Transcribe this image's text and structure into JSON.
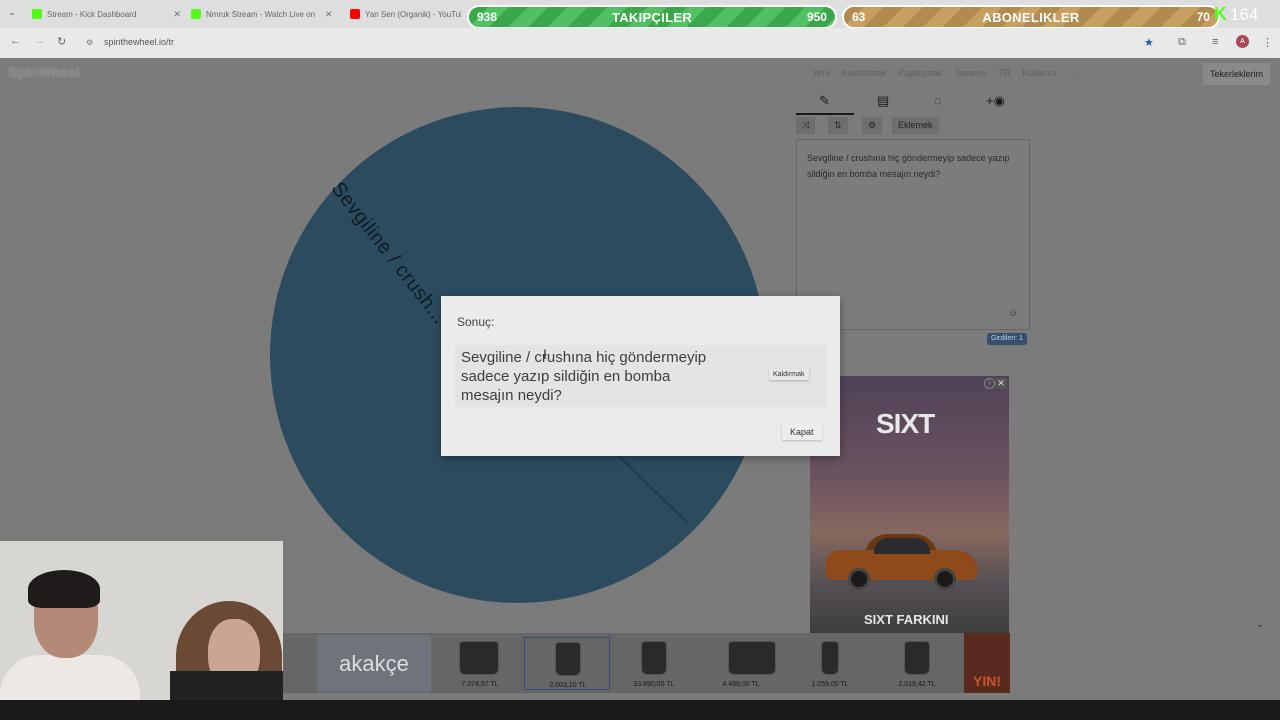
{
  "browser": {
    "tabs": [
      {
        "title": "Stream - Kick Dashboard",
        "color": "#53fc18"
      },
      {
        "title": "Nmruk Stream - Watch Live on Kick",
        "color": "#53fc18"
      },
      {
        "title": "Yan Sen (Organik) - YouTube",
        "color": "#ff0000"
      }
    ],
    "url": "spinthewheel.io/tr",
    "avatar_letter": "A"
  },
  "overlay": {
    "followers": {
      "current": "938",
      "label": "TAKIPÇILER",
      "goal": "950"
    },
    "subscribers": {
      "current": "63",
      "label": "ABONELIKLER",
      "goal": "70"
    },
    "viewers": "164"
  },
  "app": {
    "logo": "SpinWheel",
    "nav": [
      "Yeni",
      "Kaydetmek",
      "Paylaşmak",
      "Tasarım",
      "TR",
      "Kullanıcı",
      "⋮"
    ],
    "my_wheels": "Tekerleklerim",
    "panel_tools": {
      "add_image": "Eklemek"
    },
    "entry_text": "Sevgiline / crushına hiç göndermeyip sadece yazıp sildiğin en bomba mesajın neydi?",
    "entries_badge": "Girdileri: 1"
  },
  "wheel": {
    "segment_label": "Sevgiline / crush...",
    "color": "#2c4b5e"
  },
  "modal": {
    "title": "Sonuç:",
    "result": "Sevgiline / crushına hiç göndermeyip sadece yazıp sildiğin en bomba mesajın neydi?",
    "remove_label": "Kaldırmak",
    "close_label": "Kapat"
  },
  "ad": {
    "brand": "SIXT",
    "tagline": "SIXT FARKINI"
  },
  "akakce": {
    "brand": "akakçe",
    "prices": [
      "7.374,97 TL",
      "2.003,10 TL",
      "33.890,00 TL",
      "4.499,00 TL",
      "1.059,00 TL",
      "2.019,42 TL"
    ],
    "side_text": "YIN!"
  }
}
